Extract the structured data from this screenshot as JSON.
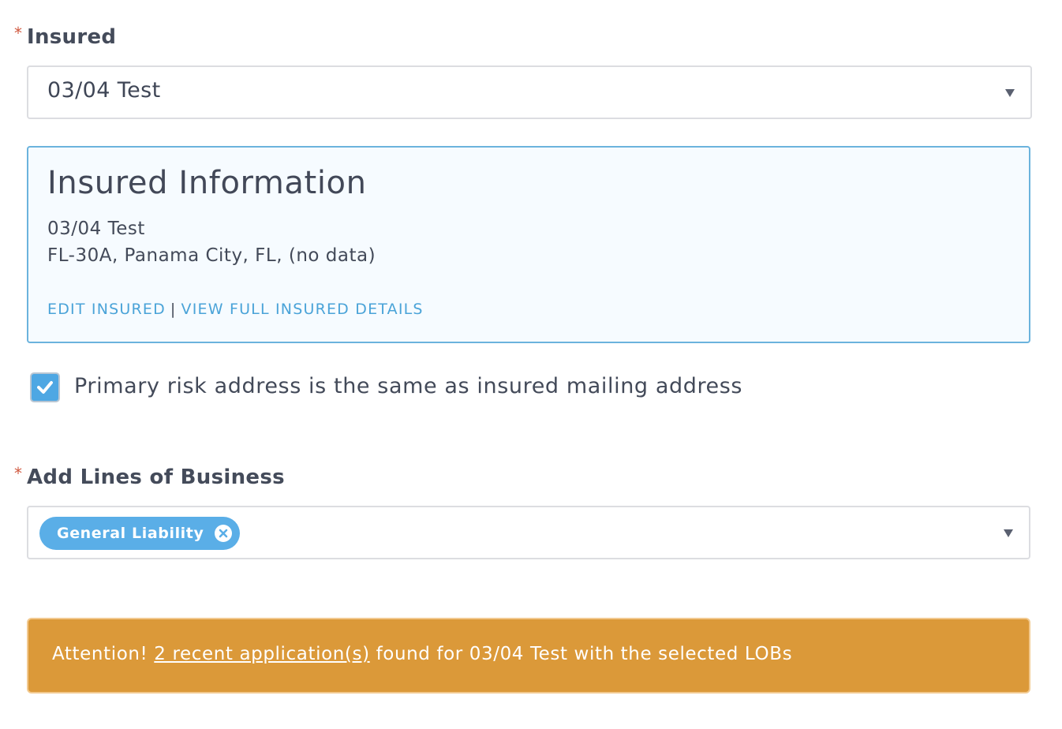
{
  "insured": {
    "label": "Insured",
    "required_mark": "*",
    "selected_value": "03/04 Test"
  },
  "insured_info": {
    "title": "Insured Information",
    "name": "03/04 Test",
    "address": "FL-30A, Panama City, FL, (no data)",
    "edit_link": "EDIT INSURED",
    "separator": "|",
    "view_link": "VIEW FULL INSURED DETAILS"
  },
  "primary_risk": {
    "checked": true,
    "label": "Primary risk address is the same as insured mailing address"
  },
  "lines_of_business": {
    "label": "Add Lines of Business",
    "required_mark": "*",
    "tags": [
      "General Liability"
    ]
  },
  "alert": {
    "prefix": "Attention!",
    "link": "2 recent application(s)",
    "suffix": "found for 03/04 Test with the selected LOBs"
  },
  "colors": {
    "accent_blue": "#4aa3d8",
    "tag_blue": "#5aaee7",
    "alert_orange": "#db9939",
    "required_red": "#d0593f"
  }
}
